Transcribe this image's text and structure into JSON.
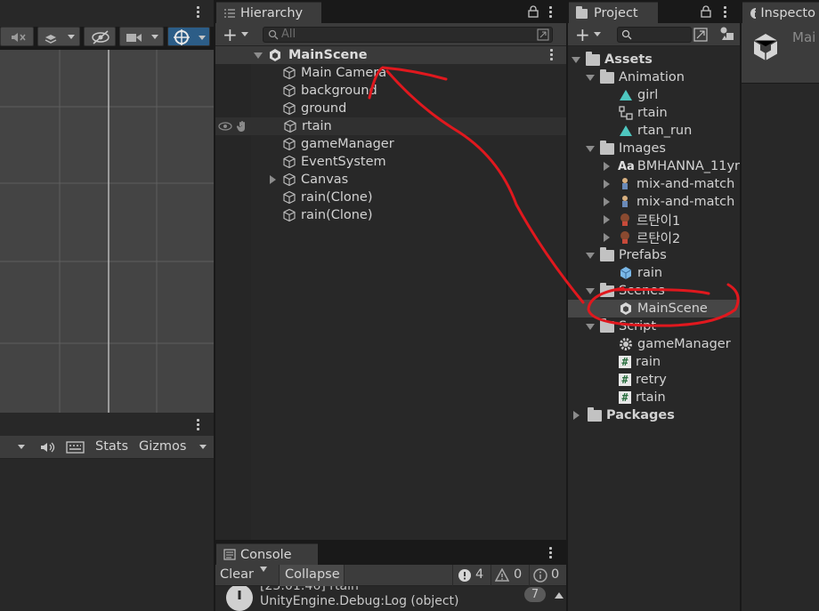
{
  "scene_toolbar": {
    "icons": [
      "audio-mute-icon",
      "effects-icon",
      "visibility-icon",
      "camera-icon",
      "gizmo-icon"
    ]
  },
  "game_toolbar": {
    "stats_label": "Stats",
    "gizmos_label": "Gizmos"
  },
  "hierarchy": {
    "tab_label": "Hierarchy",
    "search_placeholder": "All",
    "scene_name": "MainScene",
    "items": [
      {
        "label": "Main Camera"
      },
      {
        "label": "background"
      },
      {
        "label": "ground"
      },
      {
        "label": "rtain"
      },
      {
        "label": "gameManager"
      },
      {
        "label": "EventSystem"
      },
      {
        "label": "Canvas"
      },
      {
        "label": "rain(Clone)"
      },
      {
        "label": "rain(Clone)"
      }
    ]
  },
  "project": {
    "tab_label": "Project",
    "tree": {
      "assets": "Assets",
      "animation": "Animation",
      "girl": "girl",
      "rtain": "rtain",
      "rtan_run": "rtan_run",
      "images": "Images",
      "font": "BMHANNA_11yr",
      "mix1": "mix-and-match",
      "mix2": "mix-and-match",
      "kr1": "르탄이1",
      "kr2": "르탄이2",
      "prefabs": "Prefabs",
      "rain_prefab": "rain",
      "scenes": "Scenes",
      "mainscene": "MainScene",
      "script": "Script",
      "s_gamemanager": "gameManager",
      "s_rain": "rain",
      "s_retry": "retry",
      "s_rtain": "rtain",
      "packages": "Packages"
    }
  },
  "inspector": {
    "tab_label": "Inspecto",
    "object_name": "Mai"
  },
  "console": {
    "tab_label": "Console",
    "clear_label": "Clear",
    "collapse_label": "Collapse",
    "error_count": "4",
    "warning_count": "0",
    "info_count": "0",
    "log_partial": "[23:01:46] rtain",
    "log_line": "UnityEngine.Debug:Log (object)",
    "log_count": "7"
  },
  "colors": {
    "annotation": "#e0181e",
    "selection": "#2c5d87",
    "panel": "#282828"
  }
}
